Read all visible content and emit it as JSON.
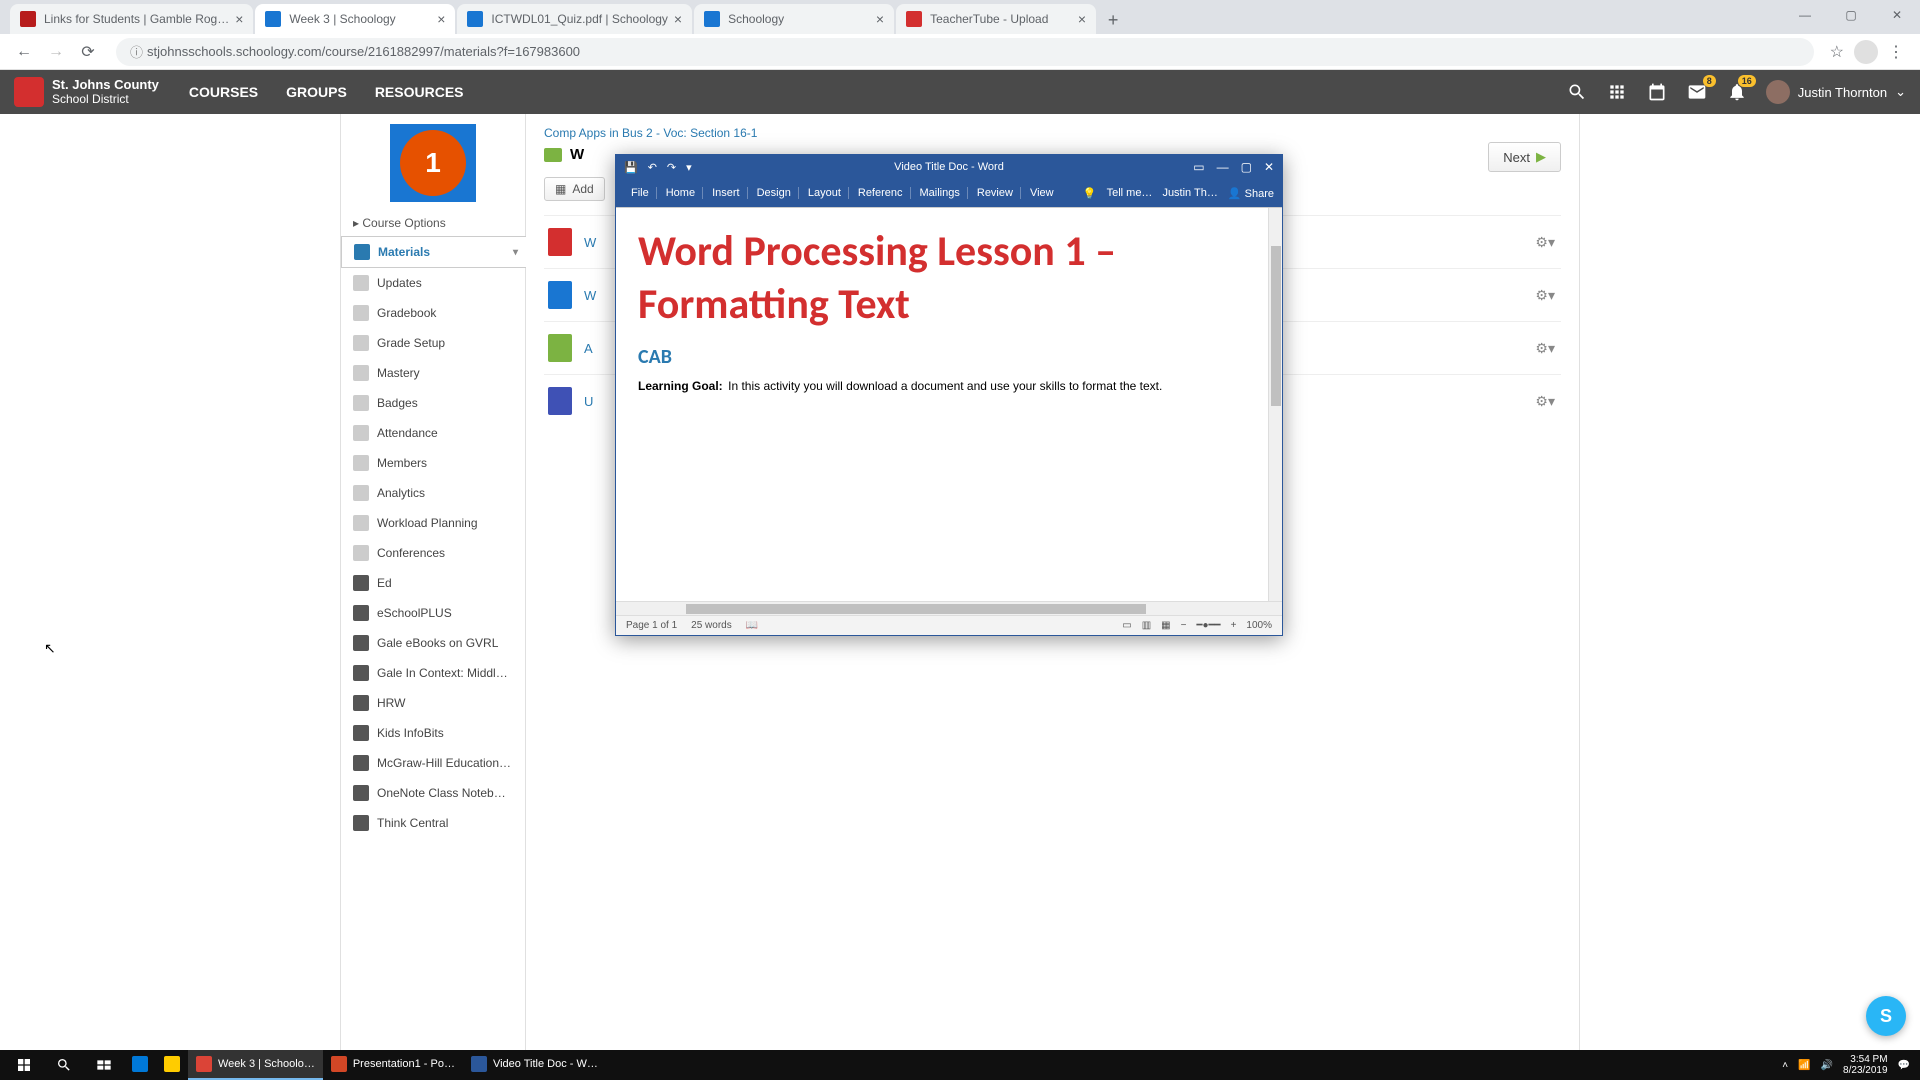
{
  "browser": {
    "tabs": [
      {
        "title": "Links for Students | Gamble Rog…",
        "favicon_color": "#b71c1c"
      },
      {
        "title": "Week 3 | Schoology",
        "favicon_color": "#1976d2",
        "active": true
      },
      {
        "title": "ICTWDL01_Quiz.pdf | Schoology",
        "favicon_color": "#1976d2"
      },
      {
        "title": "Schoology",
        "favicon_color": "#1976d2"
      },
      {
        "title": "TeacherTube - Upload",
        "favicon_color": "#d32f2f"
      }
    ],
    "url": "stjohnsschools.schoology.com/course/2161882997/materials?f=167983600"
  },
  "schoology": {
    "logo_line1": "St. Johns County",
    "logo_line2": "School District",
    "nav": [
      "COURSES",
      "GROUPS",
      "RESOURCES"
    ],
    "mail_badge": "8",
    "bell_badge": "16",
    "user_name": "Justin Thornton",
    "course_number": "1",
    "course_options": "Course Options",
    "sidebar": [
      {
        "label": "Materials",
        "active": true
      },
      {
        "label": "Updates"
      },
      {
        "label": "Gradebook"
      },
      {
        "label": "Grade Setup"
      },
      {
        "label": "Mastery"
      },
      {
        "label": "Badges"
      },
      {
        "label": "Attendance"
      },
      {
        "label": "Members"
      },
      {
        "label": "Analytics"
      },
      {
        "label": "Workload Planning"
      },
      {
        "label": "Conferences"
      },
      {
        "label": "Ed"
      },
      {
        "label": "eSchoolPLUS"
      },
      {
        "label": "Gale eBooks on GVRL"
      },
      {
        "label": "Gale In Context: Middl…"
      },
      {
        "label": "HRW"
      },
      {
        "label": "Kids InfoBits"
      },
      {
        "label": "McGraw-Hill Education…"
      },
      {
        "label": "OneNote Class Noteb…"
      },
      {
        "label": "Think Central"
      }
    ],
    "breadcrumb": "Comp Apps in Bus 2 - Voc: Section 16-1",
    "folder_title": "W",
    "add_button": "Add",
    "next_button": "Next",
    "materials": [
      {
        "icon": "pdf",
        "label": "W"
      },
      {
        "icon": "doc",
        "label": "W"
      },
      {
        "icon": "asg",
        "label": "A"
      },
      {
        "icon": "upl",
        "label": "U"
      }
    ]
  },
  "word": {
    "title": "Video Title Doc - Word",
    "ribbon_tabs": [
      "File",
      "Home",
      "Insert",
      "Design",
      "Layout",
      "Referenc",
      "Mailings",
      "Review",
      "View"
    ],
    "tell_me": "Tell me…",
    "user_short": "Justin Th…",
    "share": "Share",
    "doc_heading": "Word Processing Lesson 1 – Formatting Text",
    "doc_subtitle": "CAB",
    "doc_goal_label": "Learning Goal:",
    "doc_goal_text": "In this activity you will download a document and use your skills to format the text.",
    "page_info": "Page 1 of 1",
    "word_count": "25 words",
    "zoom": "100%"
  },
  "taskbar": {
    "apps": [
      {
        "label": "",
        "color": "#0078d7",
        "active": false
      },
      {
        "label": "",
        "color": "#ffcc00",
        "active": false
      },
      {
        "label": "Week 3 | Schoolo…",
        "color": "#db4437",
        "active": true
      },
      {
        "label": "Presentation1 - Po…",
        "color": "#d24726",
        "active": false
      },
      {
        "label": "Video Title Doc - W…",
        "color": "#2b579a",
        "active": false
      }
    ],
    "time": "3:54 PM",
    "date": "8/23/2019"
  },
  "chat_bubble": "S"
}
